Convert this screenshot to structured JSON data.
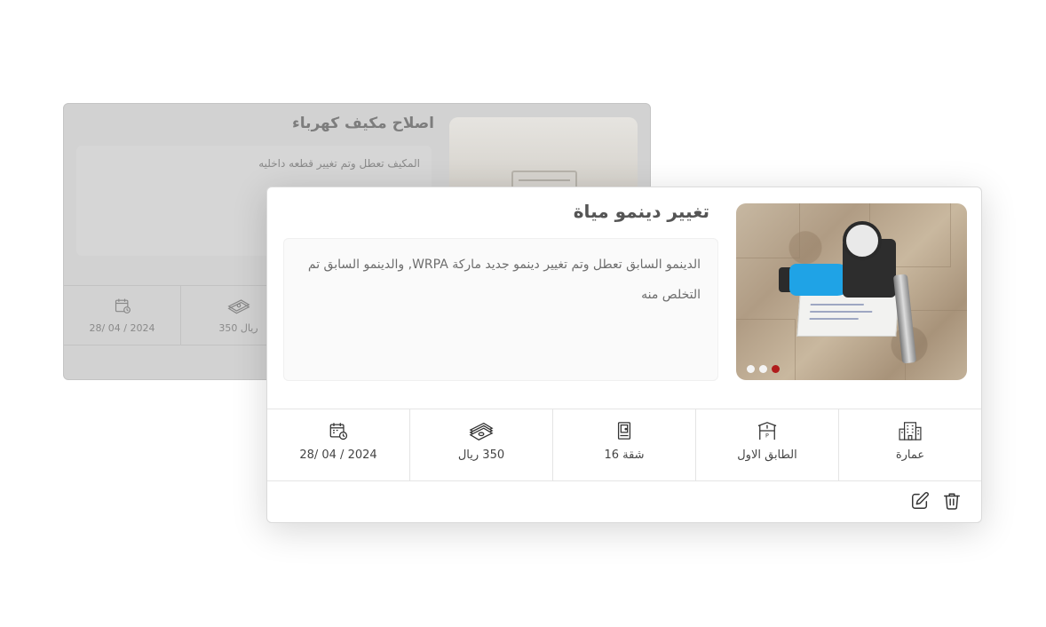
{
  "background_card": {
    "title": "اصلاح مكيف كهرباء",
    "description": "المكيف تعطل  وتم تغيير قطعه داخليه",
    "stats": [
      {
        "icon": "calendar-icon",
        "value": "28/ 04 / 2024"
      },
      {
        "icon": "money-icon",
        "value": "350 ريال"
      }
    ]
  },
  "card": {
    "title": "تغيير دينمو مياة",
    "description": "الدينمو السابق تعطل وتم تغيير دينمو جديد ماركة WRPA, والدينمو السابق تم التخلص منه",
    "image": {
      "icon": "water-pump-photo",
      "slides": 3,
      "active_slide": 3
    },
    "stats": [
      {
        "icon": "calendar-icon",
        "value": "28/ 04 / 2024"
      },
      {
        "icon": "money-icon",
        "value": "350 ريال"
      },
      {
        "icon": "apartment-door-icon",
        "value": "شقة 16"
      },
      {
        "icon": "floor-icon",
        "value": "الطابق الاول"
      },
      {
        "icon": "building-icon",
        "value": "عمارة"
      }
    ],
    "actions": [
      {
        "icon": "edit-icon"
      },
      {
        "icon": "trash-icon"
      }
    ]
  },
  "colors": {
    "accent_dot": "#b01c1c",
    "text": "#444444",
    "overlay": "#d2d2d2"
  }
}
